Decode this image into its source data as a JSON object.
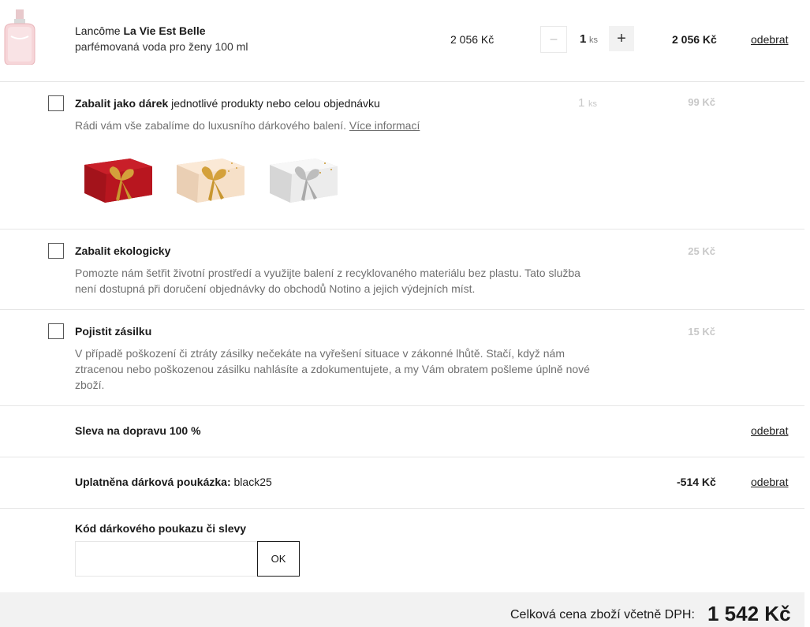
{
  "product": {
    "brand": "Lancôme",
    "name": "La Vie Est Belle",
    "subtitle": "parfémovaná voda pro ženy 100 ml",
    "unit_price": "2 056 Kč",
    "quantity": "1",
    "quantity_unit": "ks",
    "minus_label": "−",
    "plus_label": "+",
    "total_price": "2 056 Kč",
    "remove_label": "odebrat",
    "thumbnail_icon": "perfume-bottle-icon"
  },
  "gift_wrap": {
    "title_bold": "Zabalit jako dárek",
    "title_rest": " jednotlivé produkty nebo celou objednávku",
    "description": "Rádi vám vše zabalíme do luxusního dárkového balení. ",
    "more_link": "Více informací",
    "quantity": "1",
    "quantity_unit": "ks",
    "price": "99 Kč",
    "box_colors": [
      "#b8161f",
      "#f6e0c8",
      "#ececec"
    ],
    "box_icons": [
      "red-gift-box-icon",
      "cream-gift-box-icon",
      "white-gift-box-icon"
    ]
  },
  "eco_wrap": {
    "title": "Zabalit ekologicky",
    "description": "Pomozte nám šetřit životní prostředí a využijte balení z recyklovaného materiálu bez plastu. Tato služba není dostupná při doručení objednávky do obchodů Notino a jejich výdejních míst.",
    "price": "25 Kč"
  },
  "insurance": {
    "title": "Pojistit zásilku",
    "description": "V případě poškození či ztráty zásilky nečekáte na vyřešení situace v zákonné lhůtě. Stačí, když nám ztracenou nebo poškozenou zásilku nahlásíte a zdokumentujete, a my Vám obratem pošleme úplně nové zboží.",
    "price": "15 Kč"
  },
  "shipping_discount": {
    "label": "Sleva na dopravu 100 %",
    "remove_label": "odebrat"
  },
  "voucher": {
    "label_bold": "Uplatněna dárková poukázka:",
    "code": " black25",
    "amount": "-514 Kč",
    "remove_label": "odebrat"
  },
  "discount_code": {
    "label": "Kód dárkového poukazu či slevy",
    "placeholder": "",
    "button_label": "OK"
  },
  "summary": {
    "label": "Celková cena zboží včetně DPH:",
    "total": "1 542 Kč"
  }
}
